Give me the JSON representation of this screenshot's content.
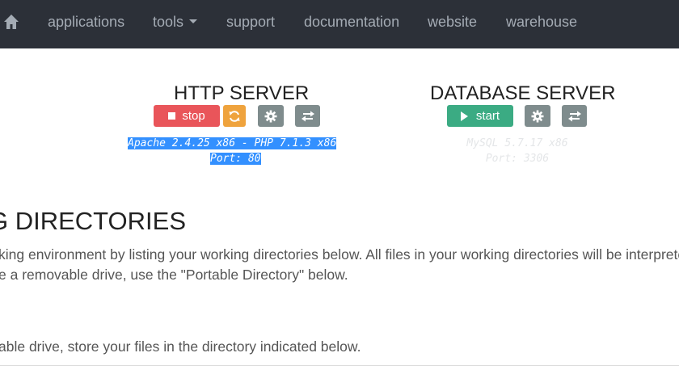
{
  "nav": {
    "items": [
      {
        "label": "applications"
      },
      {
        "label": "tools"
      },
      {
        "label": "support"
      },
      {
        "label": "documentation"
      },
      {
        "label": "website"
      },
      {
        "label": "warehouse"
      }
    ]
  },
  "http_server": {
    "title": "HTTP SERVER",
    "stop_label": "stop",
    "info_line1": "Apache 2.4.25 x86 - PHP 7.1.3 x86",
    "info_line2": "Port: 80"
  },
  "database_server": {
    "title": "DATABASE SERVER",
    "start_label": "start",
    "info_line1": "MySQL 5.7.17 x86",
    "info_line2": "Port: 3306"
  },
  "directories": {
    "heading": "G DIRECTORIES",
    "paragraph_line1": "king environment by listing your working directories below. All files in your working directories will be interprete",
    "paragraph_line2": "e a removable drive, use the \"Portable Directory\" below.",
    "portable_text": "able drive, store your files in the directory indicated below."
  },
  "colors": {
    "navbar": "#2c3038",
    "stop": "#e9555a",
    "reload": "#efa33d",
    "config": "#7f8c8d",
    "start": "#3bab83",
    "selection": "#3390ff"
  }
}
